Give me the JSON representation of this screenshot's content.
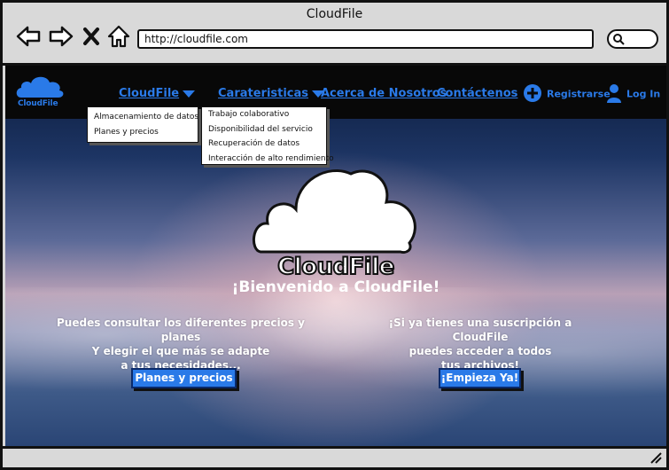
{
  "window": {
    "title": "CloudFile"
  },
  "browser": {
    "address": "http://cloudfile.com",
    "icons": [
      "back-icon",
      "forward-icon",
      "close-icon",
      "home-icon",
      "search-icon"
    ]
  },
  "nav": {
    "logo_text": "CloudFile",
    "menu_cloudfile": "CloudFile",
    "menu_caracteristicas": "Carateristicas",
    "menu_about": "Acerca de Nosotros",
    "menu_contact": "Contáctenos",
    "register": "Registrarse",
    "login": "Log In"
  },
  "dropdown_cloudfile": {
    "items": [
      "Almacenamiento de datos",
      "Planes y precios"
    ]
  },
  "dropdown_caracteristicas": {
    "items": [
      "Trabajo colaborativo",
      "Disponibilidad del servicio",
      "Recuperación de datos",
      "Interacción de alto rendimiento"
    ]
  },
  "hero": {
    "title": "CloudFile",
    "subtitle": "¡Bienvenido a CloudFile!",
    "left_line1": "Puedes consultar los diferentes precios y planes",
    "left_line2": "Y elegir el que más se adapte",
    "left_line3": "a tus necesidades...",
    "left_button": "Planes y precios",
    "right_line1": "¡Si ya tienes una suscripción a CloudFile",
    "right_line2": "puedes acceder a todos",
    "right_line3": "tus archivos!",
    "right_button": "¡Empieza Ya!"
  },
  "colors": {
    "accent": "#2a7ae8",
    "nav_bg": "#080808",
    "chrome": "#d9d9d9"
  }
}
